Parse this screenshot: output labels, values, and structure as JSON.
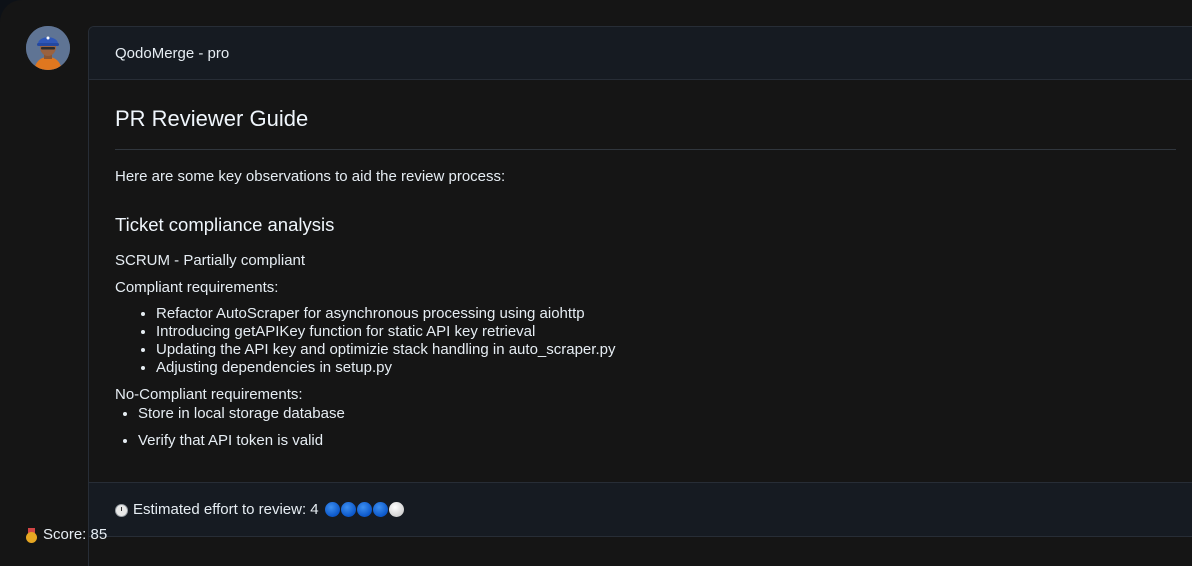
{
  "header": {
    "bot_name": "QodoMerge - pro"
  },
  "guide": {
    "title": "PR Reviewer Guide",
    "intro": "Here are some key observations to aid the review process:",
    "ticket_title": "Ticket compliance analysis",
    "ticket_status": "SCRUM - Partially compliant",
    "compliant_label": "Compliant requirements:",
    "compliant_items": [
      "Refactor AutoScraper for asynchronous processing using aiohttp",
      "Introducing getAPIKey function for static API key retrieval",
      "Updating the API key and optimizie stack handling in auto_scraper.py",
      "Adjusting dependencies in setup.py"
    ],
    "noncompliant_label": "No-Compliant requirements:",
    "noncompliant_items": [
      "Store in local storage database",
      "Verify that API token is valid"
    ]
  },
  "effort": {
    "label": "Estimated effort to review: 4",
    "value": 4,
    "max": 5,
    "icon": "stopwatch-icon",
    "filled_color": "#0b57c9",
    "empty_color": "#e8e8e8"
  },
  "score": {
    "label": "Score: 85",
    "icon": "medal-icon"
  }
}
